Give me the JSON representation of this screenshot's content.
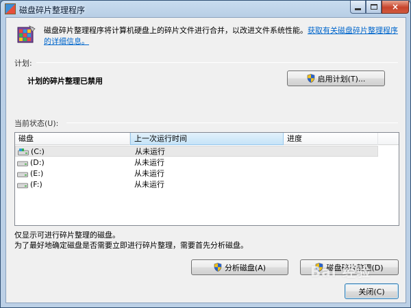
{
  "window": {
    "title": "磁盘碎片整理程序",
    "controls": {
      "minimize": "minimize",
      "maximize": "maximize",
      "close": "×"
    }
  },
  "intro": {
    "text": "磁盘碎片整理程序将计算机硬盘上的碎片文件进行合并，以改进文件系统性能。",
    "link": "获取有关磁盘碎片整理程序的详细信息。"
  },
  "schedule": {
    "label": "计划:",
    "status": "计划的碎片整理已禁用",
    "enable_button": "启用计划(T)..."
  },
  "current_status": {
    "label": "当前状态(U):",
    "columns": [
      "磁盘",
      "上一次运行时间",
      "进度"
    ],
    "rows": [
      {
        "disk": "(C:)",
        "last_run": "从未运行",
        "progress": "",
        "icon": "system-drive-icon"
      },
      {
        "disk": "(D:)",
        "last_run": "从未运行",
        "progress": "",
        "icon": "drive-icon"
      },
      {
        "disk": "(E:)",
        "last_run": "从未运行",
        "progress": "",
        "icon": "drive-icon"
      },
      {
        "disk": "(F:)",
        "last_run": "从未运行",
        "progress": "",
        "icon": "drive-icon"
      }
    ]
  },
  "notes": {
    "line1": "仅显示可进行碎片整理的磁盘。",
    "line2": "为了最好地确定磁盘是否需要立即进行碎片整理，需要首先分析磁盘。"
  },
  "buttons": {
    "analyze": "分析磁盘(A)",
    "defrag": "磁盘碎片整理(D)",
    "close": "关闭(C)"
  },
  "watermark": "Bai 经验",
  "colors": {
    "link": "#0066cc",
    "shield_blue": "#2a62c9",
    "shield_yellow": "#f2c21b"
  }
}
